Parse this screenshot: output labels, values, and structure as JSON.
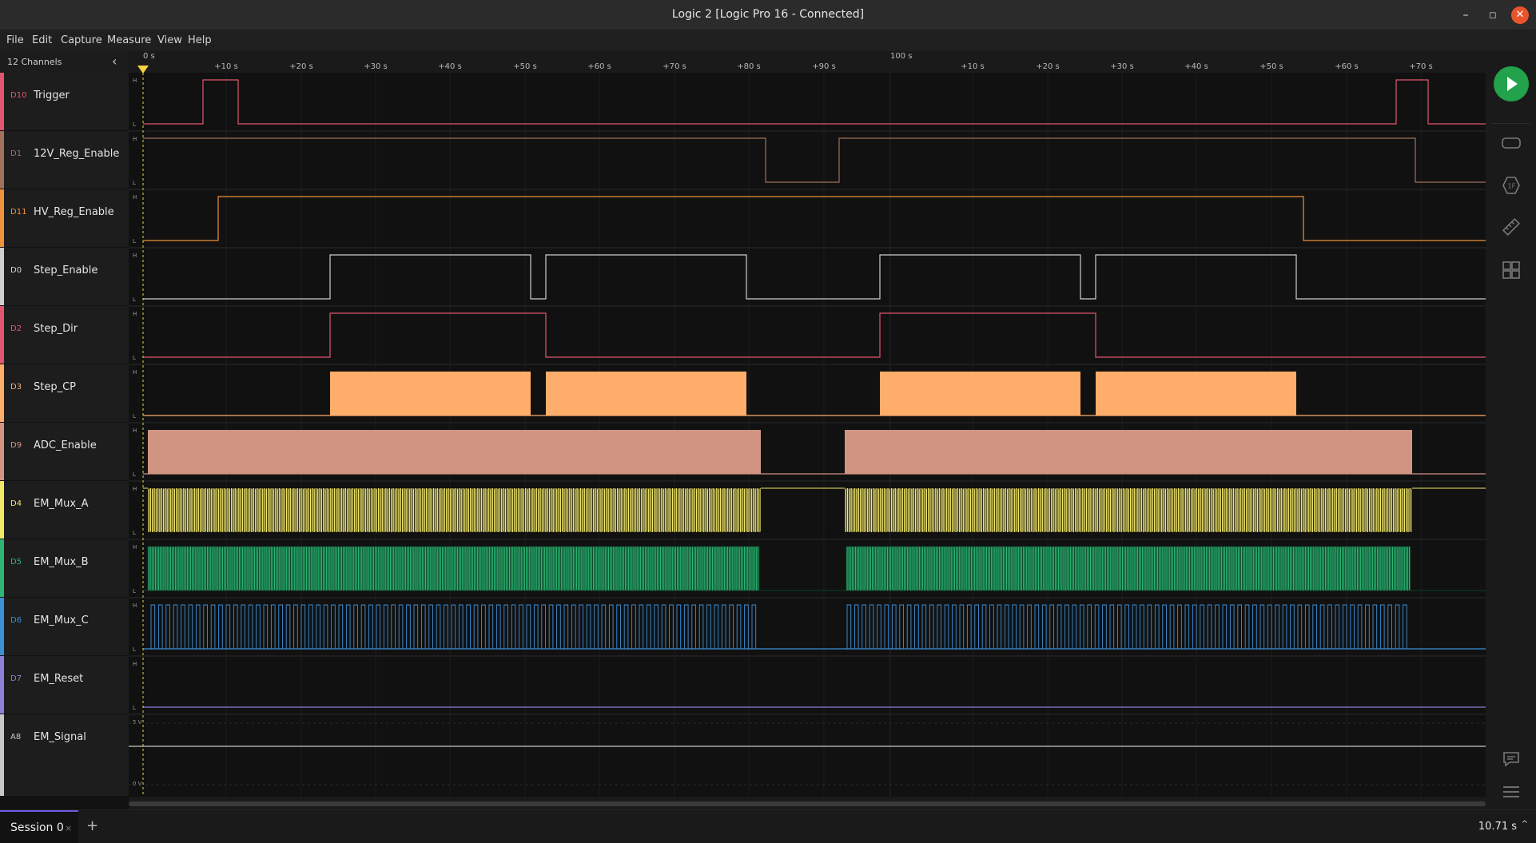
{
  "window": {
    "title": "Logic 2 [Logic Pro 16 - Connected]",
    "minimize": "–",
    "maximize": "◻",
    "close": "✕"
  },
  "menu": [
    "File",
    "Edit",
    "Capture",
    "Measure",
    "View",
    "Help"
  ],
  "channel_panel": {
    "count_label": "12 Channels"
  },
  "ruler": {
    "start_label": "0 s",
    "ticks": [
      "+10 s",
      "+20 s",
      "+30 s",
      "+40 s",
      "+50 s",
      "+60 s",
      "+70 s",
      "+80 s",
      "+90 s",
      "+10 s",
      "+20 s",
      "+30 s",
      "+40 s",
      "+50 s",
      "+60 s",
      "+70 s"
    ],
    "major_label": "100 s",
    "trigger_marker": "T"
  },
  "channels": [
    {
      "id": "D10",
      "name": "Trigger",
      "color": "#e0566f"
    },
    {
      "id": "D1",
      "name": "12V_Reg_Enable",
      "color": "#a0705b"
    },
    {
      "id": "D11",
      "name": "HV_Reg_Enable",
      "color": "#f0913c"
    },
    {
      "id": "D0",
      "name": "Step_Enable",
      "color": "#cfcfcf"
    },
    {
      "id": "D2",
      "name": "Step_Dir",
      "color": "#e0566f"
    },
    {
      "id": "D3",
      "name": "Step_CP",
      "color": "#ffad6a"
    },
    {
      "id": "D9",
      "name": "ADC_Enable",
      "color": "#d49482"
    },
    {
      "id": "D4",
      "name": "EM_Mux_A",
      "color": "#f2e86a"
    },
    {
      "id": "D5",
      "name": "EM_Mux_B",
      "color": "#2bb673"
    },
    {
      "id": "D6",
      "name": "EM_Mux_C",
      "color": "#3d8fd6"
    },
    {
      "id": "D7",
      "name": "EM_Reset",
      "color": "#8f7fd8"
    },
    {
      "id": "A8",
      "name": "EM_Signal",
      "color": "#c8c8c8"
    }
  ],
  "level_labels": {
    "high": "H",
    "low": "L",
    "analog_high": "5 V",
    "analog_low": "0 V"
  },
  "session": {
    "tab_label": "Session 0",
    "close": "×",
    "add": "+"
  },
  "capture": {
    "duration": "10.71 s",
    "duration_chevron": "^"
  },
  "toolbar_icons": [
    "play-icon",
    "analyzers-icon",
    "extensions-icon",
    "measure-icon",
    "grid-icon",
    "notes-icon",
    "menu-icon"
  ]
}
